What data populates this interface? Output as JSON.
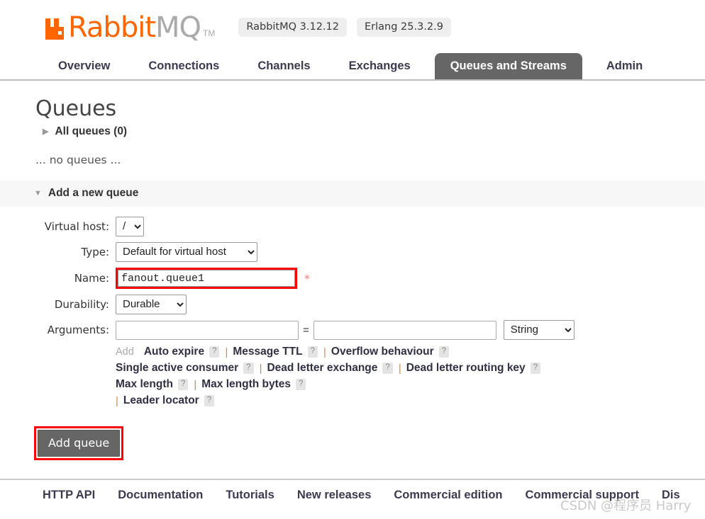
{
  "header": {
    "logo_rabbit": "Rabbit",
    "logo_mq": "MQ",
    "logo_tm": "TM",
    "logo_icon": "rabbitmq-logo-icon",
    "versions": [
      {
        "label": "RabbitMQ 3.12.12"
      },
      {
        "label": "Erlang 25.3.2.9"
      }
    ]
  },
  "tabs": [
    {
      "label": "Overview",
      "active": false
    },
    {
      "label": "Connections",
      "active": false
    },
    {
      "label": "Channels",
      "active": false
    },
    {
      "label": "Exchanges",
      "active": false
    },
    {
      "label": "Queues and Streams",
      "active": true
    },
    {
      "label": "Admin",
      "active": false
    }
  ],
  "main": {
    "page_title": "Queues",
    "all_queues_label": "All queues (0)",
    "no_queues_text": "... no queues ...",
    "section_title": "Add a new queue"
  },
  "form": {
    "labels": {
      "virtual_host": "Virtual host:",
      "type": "Type:",
      "name": "Name:",
      "durability": "Durability:",
      "arguments": "Arguments:"
    },
    "virtual_host_value": "/",
    "type_value": "Default for virtual host",
    "name_value": "fanout.queue1",
    "name_placeholder": "",
    "required_marker": "*",
    "durability_value": "Durable",
    "argument_key_value": "",
    "argument_key_placeholder": "",
    "argument_val_value": "",
    "argument_val_placeholder": "",
    "equals_sign": "=",
    "argument_type_value": "String",
    "add_link": "Add",
    "preset_rows": [
      [
        {
          "label": "Auto expire",
          "help": "?"
        },
        {
          "label": "Message TTL",
          "help": "?"
        },
        {
          "label": "Overflow behaviour",
          "help": "?"
        }
      ],
      [
        {
          "label": "Single active consumer",
          "help": "?"
        },
        {
          "label": "Dead letter exchange",
          "help": "?"
        },
        {
          "label": "Dead letter routing key",
          "help": "?"
        }
      ],
      [
        {
          "label": "Max length",
          "help": "?"
        },
        {
          "label": "Max length bytes",
          "help": "?"
        }
      ],
      [
        {
          "label": "Leader locator",
          "help": "?"
        }
      ]
    ],
    "separator": "|",
    "submit_label": "Add queue"
  },
  "footer": {
    "links": [
      {
        "label": "HTTP API"
      },
      {
        "label": "Documentation"
      },
      {
        "label": "Tutorials"
      },
      {
        "label": "New releases"
      },
      {
        "label": "Commercial edition"
      },
      {
        "label": "Commercial support"
      },
      {
        "label": "Dis"
      }
    ],
    "watermark": "CSDN @程序员 Harry"
  },
  "colors": {
    "brand_orange": "#ff6600",
    "active_tab_bg": "#666666",
    "annotation_red": "#ff0000",
    "required_star": "#f08080",
    "section_bg": "#f7f7f7"
  }
}
